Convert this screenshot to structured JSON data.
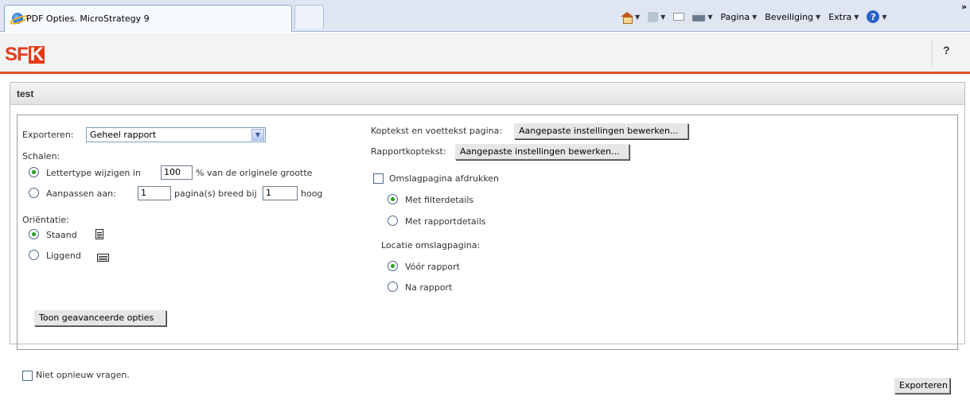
{
  "browser": {
    "tab_title": "PDF Opties. MicroStrategy 9",
    "menu": {
      "pagina": "Pagina",
      "beveiliging": "Beveiliging",
      "extra": "Extra"
    },
    "chevron": "»"
  },
  "header": {
    "logo_text": "SF",
    "logo_mark": "K",
    "help": "?"
  },
  "panel": {
    "title": "test"
  },
  "form": {
    "exporteren_label": "Exporteren:",
    "exporteren_value": "Geheel rapport",
    "schalen_label": "Schalen:",
    "lettertype_label": "Lettertype wijzigen in",
    "lettertype_value": "100",
    "lettertype_suffix": "% van de originele grootte",
    "aanpassen_label": "Aanpassen aan:",
    "breed_value": "1",
    "breed_suffix": "pagina(s) breed bij",
    "hoog_value": "1",
    "hoog_suffix": "hoog",
    "orientatie_label": "Oriëntatie:",
    "staand": "Staand",
    "liggend": "Liggend",
    "advanced_button": "Toon geavanceerde opties",
    "koptekst_label": "Koptekst en voettekst pagina:",
    "koptekst_button": "Aangepaste instellingen bewerken...",
    "rapport_label": "Rapportkoptekst:",
    "rapport_button": "Aangepaste instellingen bewerken...",
    "omslag_label": "Omslagpagina afdrukken",
    "filterdetails": "Met filterdetails",
    "rapportdetails": "Met rapportdetails",
    "locatie_label": "Locatie omslagpagina:",
    "voor_rapport": "Vóór rapport",
    "na_rapport": "Na rapport"
  },
  "footer": {
    "niet_opnieuw": "Niet opnieuw vragen.",
    "export_button": "Exporteren"
  }
}
